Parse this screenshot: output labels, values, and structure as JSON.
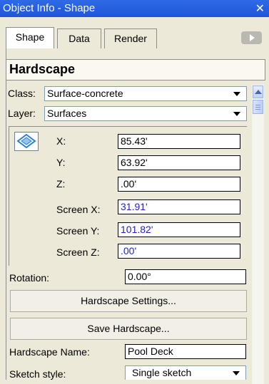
{
  "window": {
    "title": "Object Info - Shape",
    "close_glyph": "✕"
  },
  "tabs": [
    {
      "label": "Shape",
      "active": true
    },
    {
      "label": "Data",
      "active": false
    },
    {
      "label": "Render",
      "active": false
    }
  ],
  "header": {
    "title": "Hardscape"
  },
  "class_row": {
    "label": "Class:",
    "value": "Surface-concrete"
  },
  "layer_row": {
    "label": "Layer:",
    "value": "Surfaces"
  },
  "coords": [
    {
      "label": "X:",
      "value": "85.43'"
    },
    {
      "label": "Y:",
      "value": "63.92'"
    },
    {
      "label": "Z:",
      "value": ".00'"
    },
    {
      "label": "Screen X:",
      "value": "31.91'"
    },
    {
      "label": "Screen Y:",
      "value": "101.82'"
    },
    {
      "label": "Screen Z:",
      "value": ".00'"
    }
  ],
  "rotation": {
    "label": "Rotation:",
    "value": "0.00°"
  },
  "buttons": {
    "settings": "Hardscape Settings...",
    "save": "Save Hardscape..."
  },
  "name_row": {
    "label": "Hardscape Name:",
    "value": "Pool Deck"
  },
  "sketch_row": {
    "label": "Sketch style:",
    "value": "Single sketch"
  },
  "colors": {
    "titlebar": "#1e56d8",
    "screen_value_text": "#2222cc"
  },
  "icons": [
    "close-icon",
    "scroll-right-icon",
    "dropdown-arrow-icon",
    "scroll-up-icon",
    "shape-type-icon"
  ]
}
